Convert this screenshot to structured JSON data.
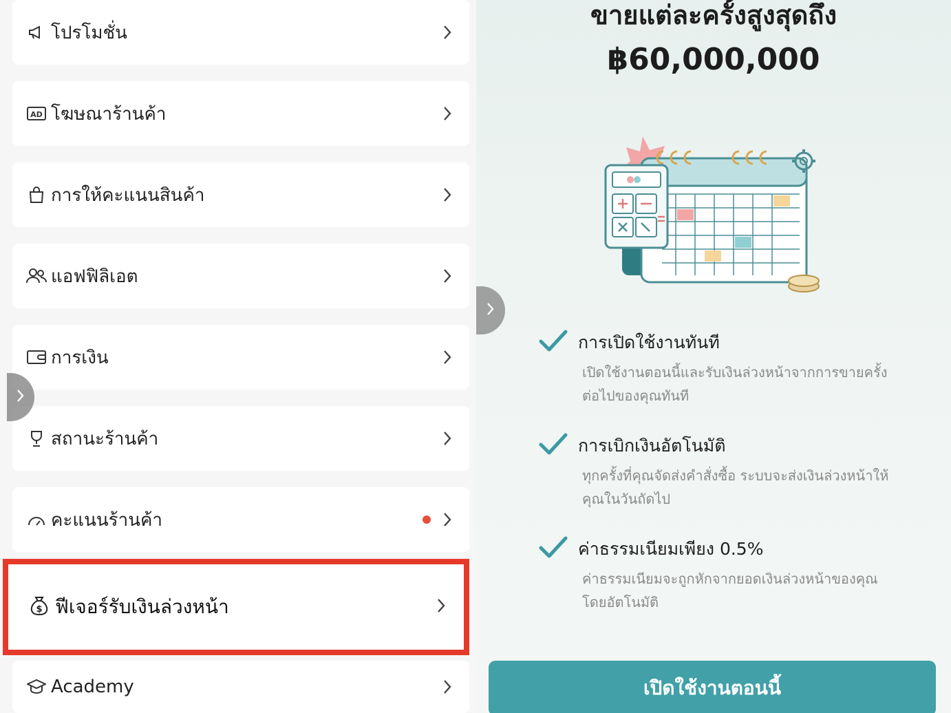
{
  "menu": {
    "items": [
      {
        "label": "โปรโมชั่น",
        "icon": "megaphone-icon"
      },
      {
        "label": "โฆษณาร้านค้า",
        "icon": "ad-icon"
      },
      {
        "label": "การให้คะแนนสินค้า",
        "icon": "shopping-bag-icon"
      },
      {
        "label": "แอฟฟิลิเอต",
        "icon": "people-icon"
      },
      {
        "label": "การเงิน",
        "icon": "wallet-icon"
      },
      {
        "label": "สถานะร้านค้า",
        "icon": "trophy-icon"
      },
      {
        "label": "คะแนนร้านค้า",
        "icon": "gauge-icon",
        "badge_color": "#e8503a"
      },
      {
        "label": "ฟีเจอร์รับเงินล่วงหน้า",
        "icon": "money-bag-icon",
        "highlight_color": "#e53a2a"
      },
      {
        "label": "Academy",
        "icon": "graduation-cap-icon"
      }
    ]
  },
  "promo": {
    "headline_line1": "ขายแต่ละครั้งสูงสุดถึง",
    "headline_line2": "฿60,000,000",
    "features": [
      {
        "title": "การเปิดใช้งานทันที",
        "desc": "เปิดใช้งานตอนนี้และรับเงินล่วงหน้าจากการขายครั้งต่อไปของคุณทันที"
      },
      {
        "title": "การเบิกเงินอัตโนมัติ",
        "desc": "ทุกครั้งที่คุณจัดส่งคำสั่งซื้อ ระบบจะส่งเงินล่วงหน้าให้คุณในวันถัดไป"
      },
      {
        "title": "ค่าธรรมเนียมเพียง 0.5%",
        "desc": "ค่าธรรมเนียมจะถูกหักจากยอดเงินล่วงหน้าของคุณโดยอัตโนมัติ"
      }
    ],
    "cta_label": "เปิดใช้งานตอนนี้",
    "accent_color": "#41a0a8",
    "check_color": "#3a9aa3"
  }
}
